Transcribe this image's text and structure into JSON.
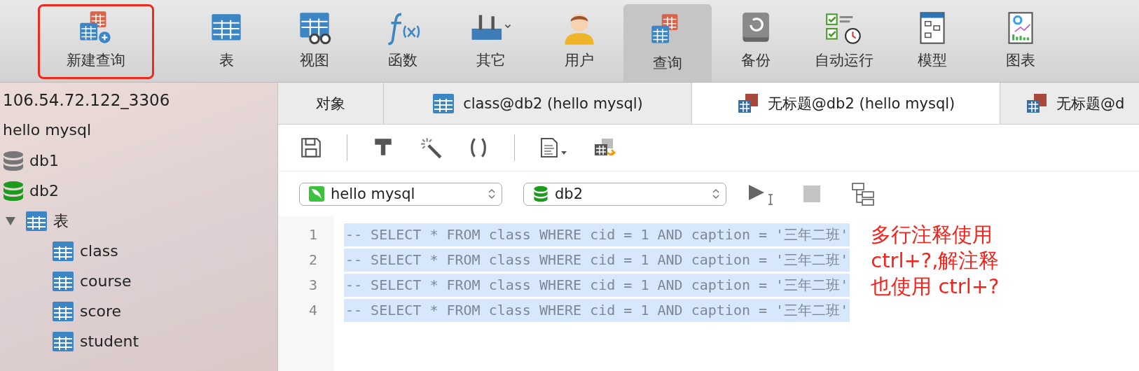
{
  "toolbar": {
    "items": [
      {
        "label": "新建查询",
        "kind": "new-query",
        "selected": false,
        "annotated": true
      },
      {
        "label": "表",
        "kind": "table",
        "selected": false,
        "annotated": false
      },
      {
        "label": "视图",
        "kind": "view",
        "selected": false,
        "annotated": false
      },
      {
        "label": "函数",
        "kind": "function",
        "selected": false,
        "annotated": false
      },
      {
        "label": "其它",
        "kind": "other",
        "selected": false,
        "annotated": false
      },
      {
        "label": "用户",
        "kind": "user",
        "selected": false,
        "annotated": false
      },
      {
        "label": "查询",
        "kind": "query",
        "selected": true,
        "annotated": false
      },
      {
        "label": "备份",
        "kind": "backup",
        "selected": false,
        "annotated": false
      },
      {
        "label": "自动运行",
        "kind": "schedule",
        "selected": false,
        "annotated": false
      },
      {
        "label": "模型",
        "kind": "model",
        "selected": false,
        "annotated": false
      },
      {
        "label": "图表",
        "kind": "chart",
        "selected": false,
        "annotated": false
      }
    ]
  },
  "sidebar": {
    "host": "106.54.72.122_3306",
    "connection": "hello mysql",
    "databases": [
      {
        "name": "db1",
        "open": false
      },
      {
        "name": "db2",
        "open": true,
        "children": [
          {
            "name": "表",
            "expanded": true,
            "children": [
              {
                "name": "class"
              },
              {
                "name": "course"
              },
              {
                "name": "score"
              },
              {
                "name": "student"
              }
            ]
          }
        ]
      }
    ]
  },
  "tabs": [
    {
      "label": "对象",
      "kind": "objects",
      "selected": false
    },
    {
      "label": "class@db2 (hello mysql)",
      "kind": "table",
      "selected": false
    },
    {
      "label": "无标题@db2 (hello mysql)",
      "kind": "query",
      "selected": true
    },
    {
      "label": "无标题@d",
      "kind": "query",
      "selected": false
    }
  ],
  "selectors": {
    "connection": "hello mysql",
    "database": "db2"
  },
  "editor": {
    "lines": [
      {
        "number": "1",
        "code": "-- SELECT * FROM class WHERE cid = 1 AND caption = '三年二班'",
        "selected": true
      },
      {
        "number": "2",
        "code": "-- SELECT * FROM class WHERE cid = 1 AND caption = '三年二班'",
        "selected": true
      },
      {
        "number": "3",
        "code": "-- SELECT * FROM class WHERE cid = 1 AND caption = '三年二班'",
        "selected": true
      },
      {
        "number": "4",
        "code": "-- SELECT * FROM class WHERE cid = 1 AND caption = '三年二班'",
        "selected": true
      }
    ],
    "annotation": [
      "多行注释使用",
      "ctrl+?,解注释",
      "也使用 ctrl+?"
    ]
  }
}
